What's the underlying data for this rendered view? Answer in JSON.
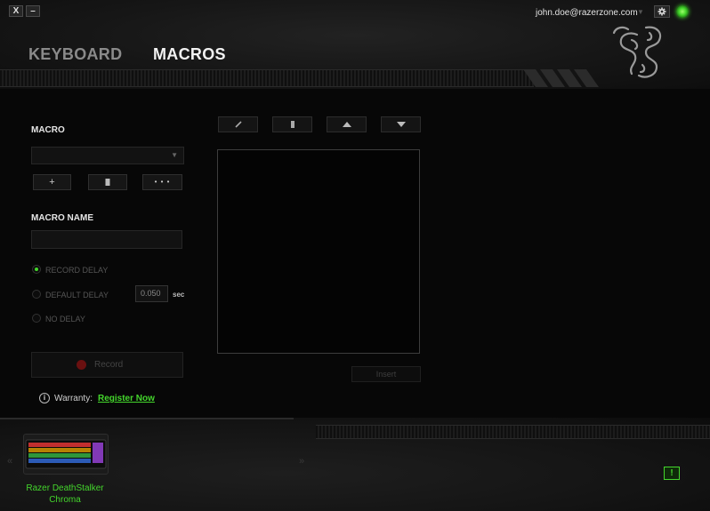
{
  "window": {
    "close_label": "X",
    "minimize_label": "–"
  },
  "header": {
    "user_email": "john.doe@razerzone.com",
    "tabs": [
      {
        "label": "KEYBOARD",
        "active": false
      },
      {
        "label": "MACROS",
        "active": true
      }
    ],
    "status_color": "#44d62c"
  },
  "macro": {
    "section_label": "MACRO",
    "selected_macro": "",
    "add_label": "+",
    "more_label": "• • •",
    "name_label": "MACRO NAME",
    "name_value": ""
  },
  "delay": {
    "options": [
      {
        "label": "RECORD DELAY",
        "selected": true
      },
      {
        "label": "DEFAULT DELAY",
        "selected": false
      },
      {
        "label": "NO DELAY",
        "selected": false
      }
    ],
    "default_value": "0.050",
    "unit": "sec"
  },
  "record": {
    "label": "Record"
  },
  "warranty": {
    "label": "Warranty:",
    "link": "Register Now"
  },
  "editor": {
    "insert_label": "Insert"
  },
  "device": {
    "name_line1": "Razer DeathStalker",
    "name_line2": "Chroma"
  },
  "alert": {
    "label": "!"
  },
  "colors": {
    "accent": "#44d62c",
    "background": "#070707"
  }
}
